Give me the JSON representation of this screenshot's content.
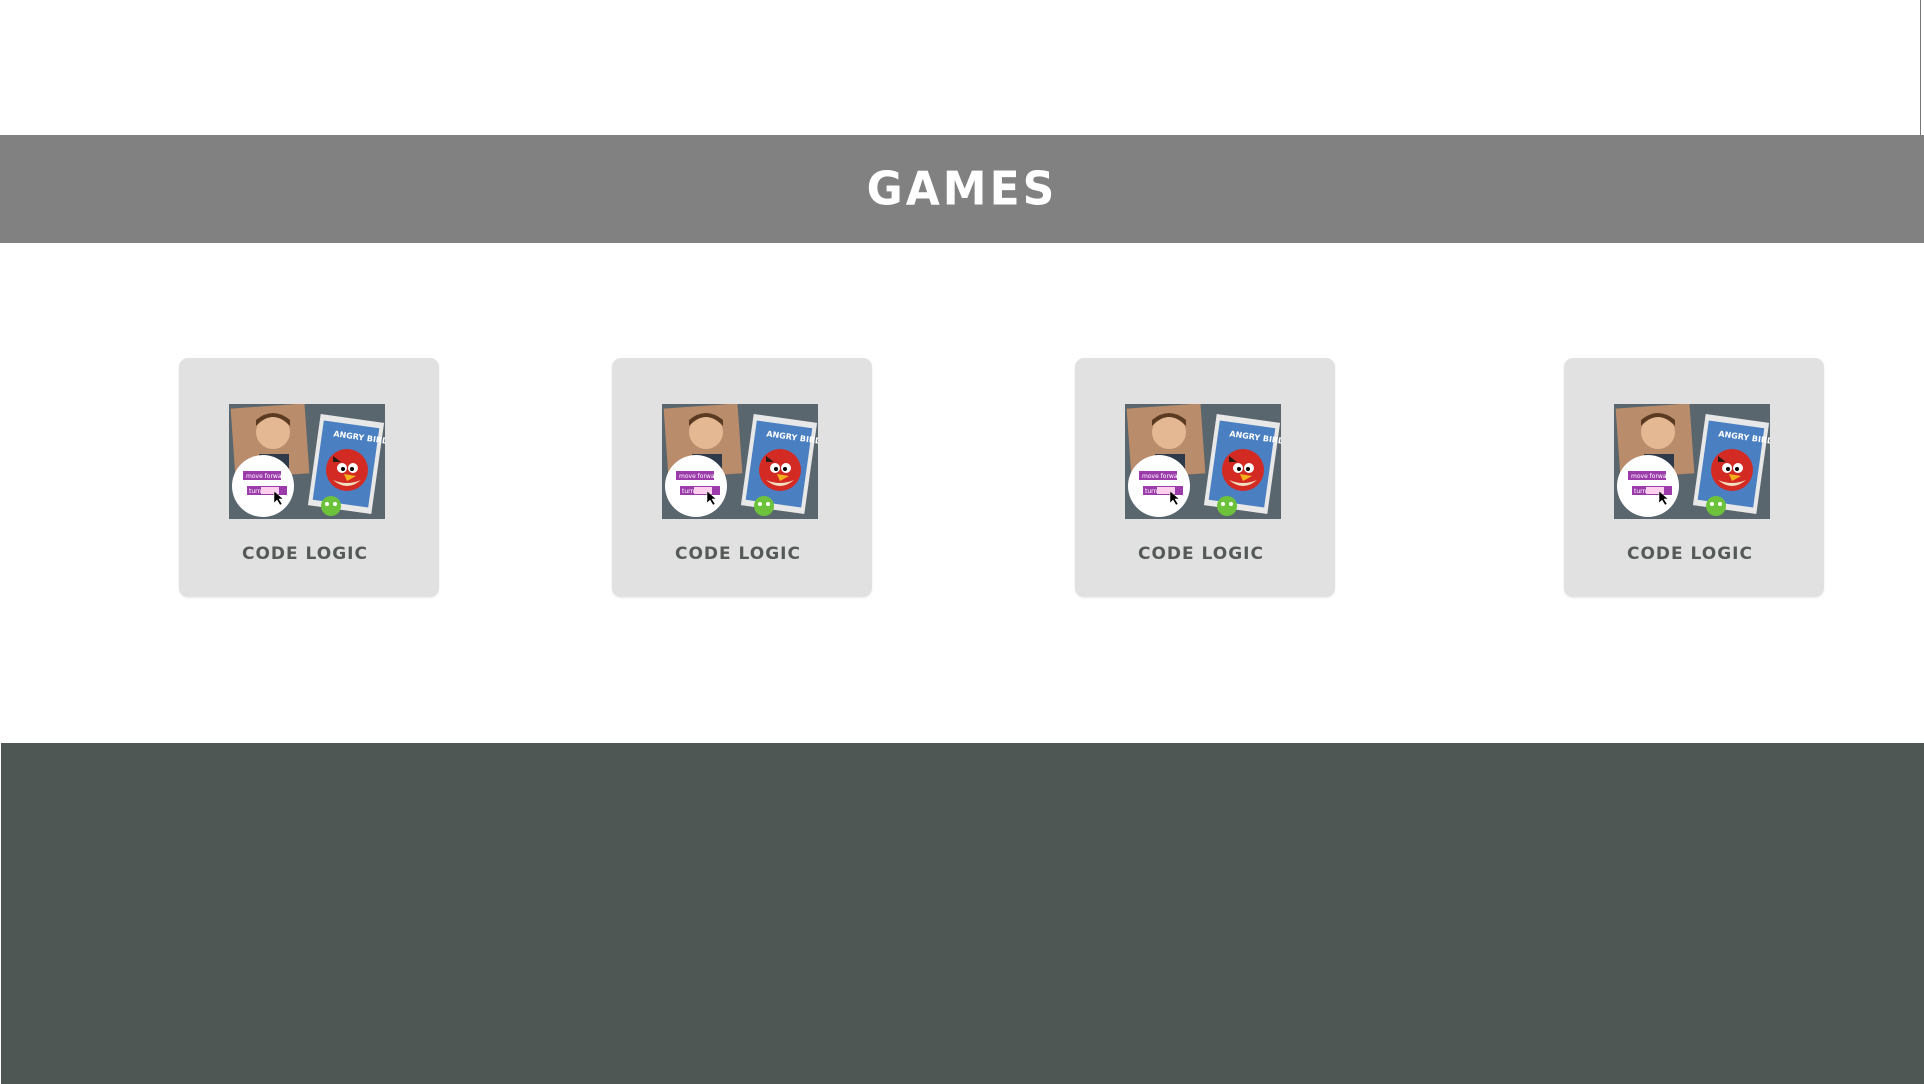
{
  "header": {
    "title": "GAMES"
  },
  "games": [
    {
      "label": "CODE LOGIC",
      "thumbnail": "code-logic-thumbnail"
    },
    {
      "label": "CODE LOGIC",
      "thumbnail": "code-logic-thumbnail"
    },
    {
      "label": "CODE LOGIC",
      "thumbnail": "code-logic-thumbnail"
    },
    {
      "label": "CODE LOGIC",
      "thumbnail": "code-logic-thumbnail"
    }
  ],
  "colors": {
    "banner": "#818181",
    "card": "#e1e1e1",
    "card_text": "#555a58",
    "footer": "#4e5754"
  }
}
